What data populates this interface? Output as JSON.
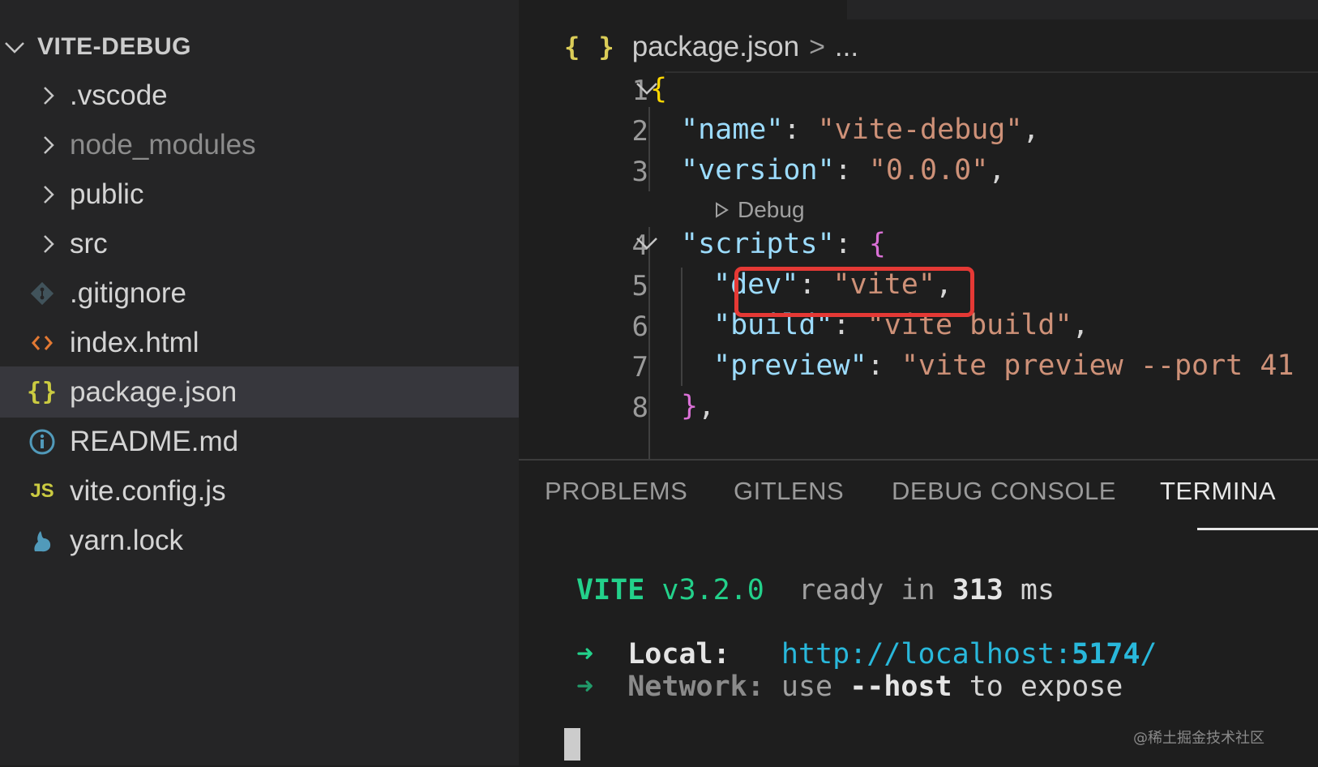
{
  "explorer": {
    "title": "VITE-DEBUG",
    "items": [
      {
        "label": ".vscode",
        "icon": "chevron-right-icon",
        "kind": "folder"
      },
      {
        "label": "node_modules",
        "icon": "chevron-right-icon",
        "kind": "folder"
      },
      {
        "label": "public",
        "icon": "chevron-right-icon",
        "kind": "folder"
      },
      {
        "label": "src",
        "icon": "chevron-right-icon",
        "kind": "folder"
      },
      {
        "label": ".gitignore",
        "icon": "git-icon",
        "kind": "file"
      },
      {
        "label": "index.html",
        "icon": "html-icon",
        "kind": "file"
      },
      {
        "label": "package.json",
        "icon": "json-braces-icon",
        "kind": "file",
        "selected": true
      },
      {
        "label": "README.md",
        "icon": "info-icon",
        "kind": "file"
      },
      {
        "label": "vite.config.js",
        "icon": "js-icon",
        "kind": "file"
      },
      {
        "label": "yarn.lock",
        "icon": "yarn-icon",
        "kind": "file"
      }
    ]
  },
  "editor": {
    "breadcrumb": {
      "icon": "{ }",
      "file": "package.json",
      "separator": ">",
      "more": "..."
    },
    "code_lens": "Debug",
    "lines": [
      {
        "n": "1",
        "text": "{"
      },
      {
        "n": "2",
        "key": "\"name\"",
        "colon": ": ",
        "value": "\"vite-debug\"",
        "tail": ","
      },
      {
        "n": "3",
        "key": "\"version\"",
        "colon": ": ",
        "value": "\"0.0.0\"",
        "tail": ","
      },
      {
        "n": "4",
        "key": "\"scripts\"",
        "colon": ": ",
        "open": "{"
      },
      {
        "n": "5",
        "key": "\"dev\"",
        "colon": ": ",
        "value": "\"vite\"",
        "tail": ","
      },
      {
        "n": "6",
        "key": "\"build\"",
        "colon": ": ",
        "value": "\"vite build\"",
        "tail": ","
      },
      {
        "n": "7",
        "key": "\"preview\"",
        "colon": ": ",
        "value": "\"vite preview --port 41"
      },
      {
        "n": "8",
        "close": "}",
        "tail": ","
      }
    ]
  },
  "panel": {
    "tabs": [
      "PROBLEMS",
      "GITLENS",
      "DEBUG CONSOLE",
      "TERMINA"
    ],
    "active_tab": "TERMINA",
    "terminal": {
      "vite": "VITE",
      "version": "v3.2.0",
      "ready": "ready in",
      "ms_value": "313",
      "ms": "ms",
      "arrow": "➜",
      "local_label": "Local:",
      "local_prefix": "http://localhost:",
      "local_port": "5174",
      "local_suffix": "/",
      "network_label": "Network:",
      "network_use": "use",
      "network_flag": "--host",
      "network_rest": "to expose"
    }
  },
  "watermark": "@稀土掘金技术社区",
  "colors": {
    "sidebar_bg": "#252526",
    "editor_bg": "#1e1e1e",
    "selection": "#37373d",
    "highlight_box": "#e53935",
    "json_key": "#9cdcfe",
    "json_string": "#ce9178",
    "vite_green": "#23d18b",
    "link_cyan": "#29b8db"
  }
}
